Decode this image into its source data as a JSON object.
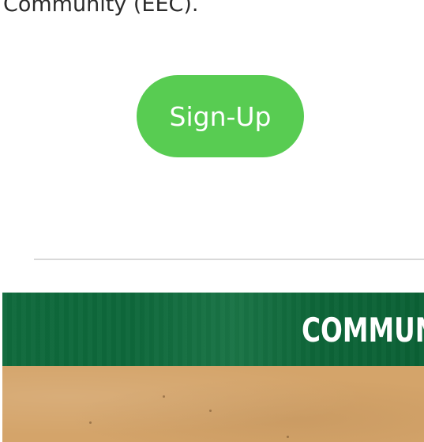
{
  "intro": {
    "text_fragment": "Community (EEC)."
  },
  "signup": {
    "label": "Sign-Up"
  },
  "banner": {
    "title_visible": "COMMUN",
    "header_color": "#0f6a3c",
    "texture_color": "#d4a46a"
  },
  "colors": {
    "button_green": "#58cc52",
    "divider": "#d9d9d9",
    "text": "#2b2b2b"
  }
}
